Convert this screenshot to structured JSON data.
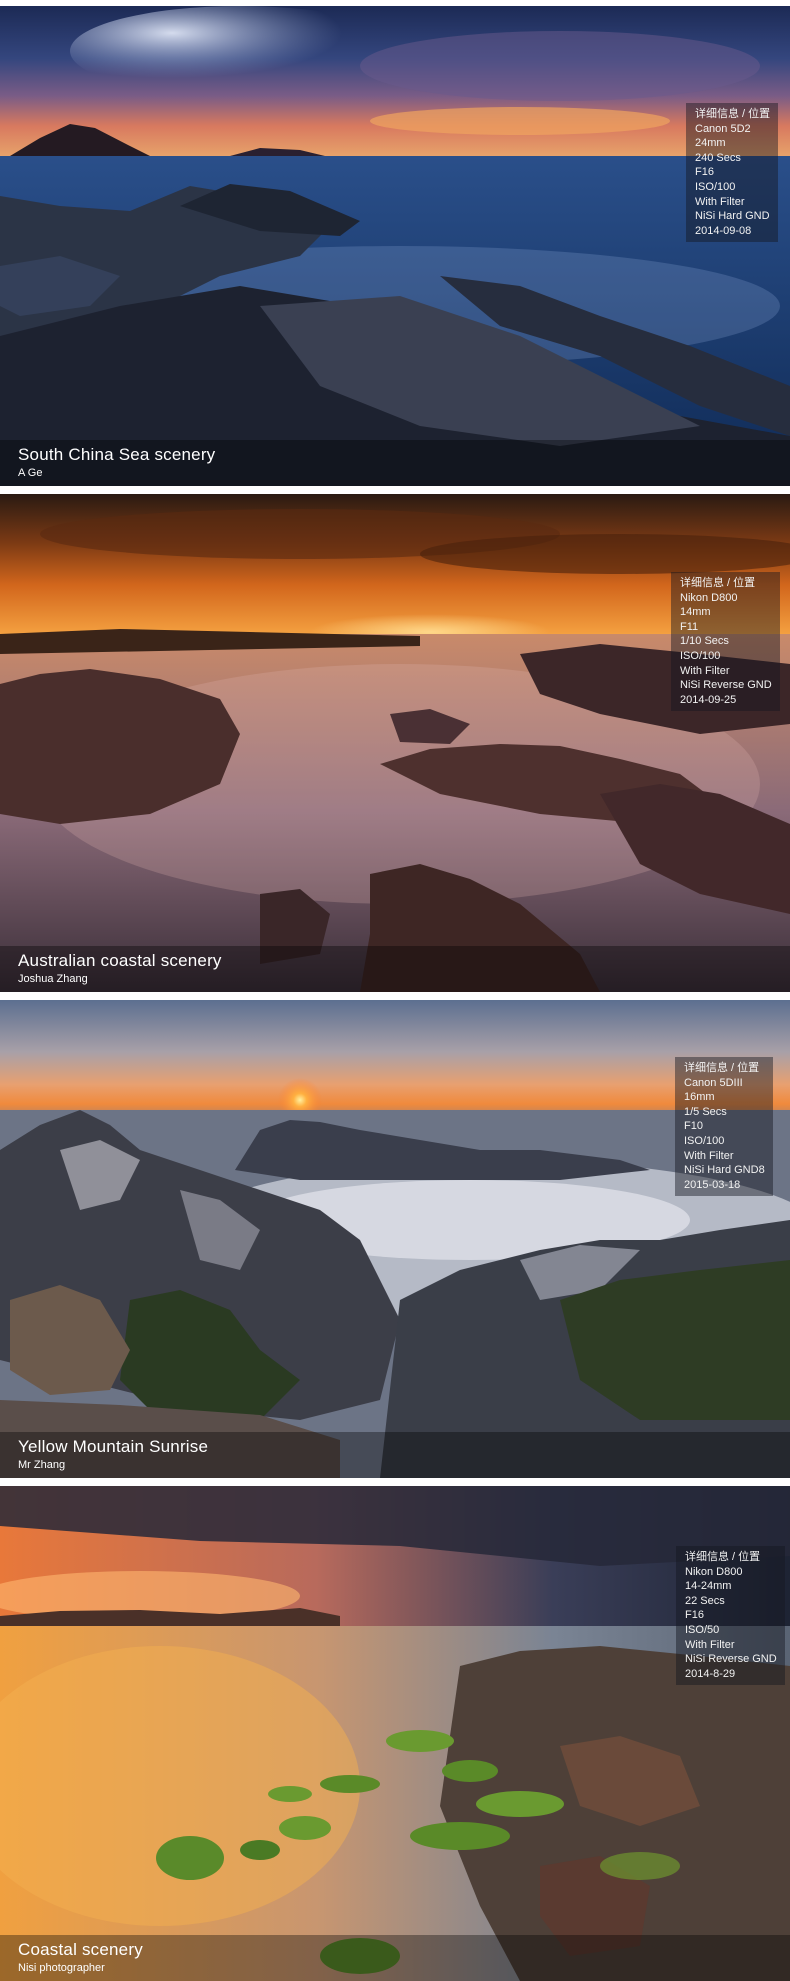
{
  "photos": [
    {
      "title": "South China Sea scenery",
      "author": "A Ge",
      "info": [
        "详细信息 / 位置",
        "Canon 5D2",
        "24mm",
        "240 Secs",
        "F16",
        "ISO/100",
        "With Filter",
        "NiSi Hard GND",
        "2014-09-08"
      ]
    },
    {
      "title": "Australian coastal scenery",
      "author": "Joshua Zhang",
      "info": [
        "详细信息 / 位置",
        "Nikon D800",
        "14mm",
        "F11",
        "1/10 Secs",
        "ISO/100",
        "With Filter",
        "NiSi Reverse GND",
        "2014-09-25"
      ]
    },
    {
      "title": "Yellow Mountain Sunrise",
      "author": "Mr Zhang",
      "info": [
        "详细信息 / 位置",
        "Canon 5DIII",
        "16mm",
        "1/5 Secs",
        "F10",
        "ISO/100",
        "With Filter",
        "NiSi Hard GND8",
        "2015-03-18"
      ]
    },
    {
      "title": "Coastal scenery",
      "author": "Nisi photographer",
      "info": [
        "详细信息 / 位置",
        "Nikon D800",
        "14-24mm",
        "22 Secs",
        "F16",
        "ISO/50",
        "With Filter",
        "NiSi Reverse GND",
        "2014-8-29"
      ]
    }
  ]
}
